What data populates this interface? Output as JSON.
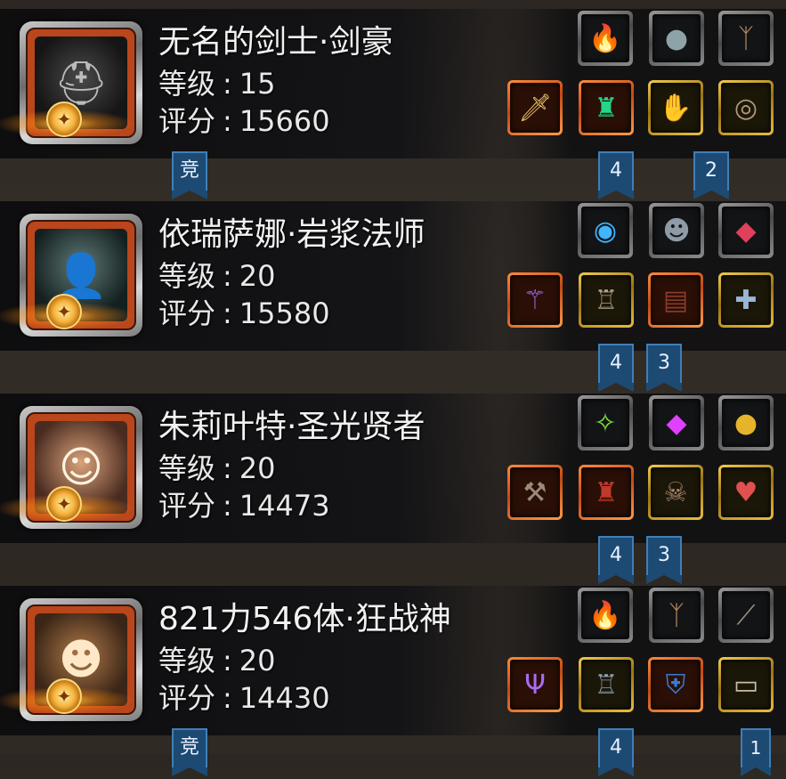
{
  "heroes": [
    {
      "name": "无名的剑士·剑豪",
      "level_label": "等级",
      "level": "15",
      "score_label": "评分",
      "score": "15660",
      "portrait_icon": "helmet-icon",
      "badge": "竞",
      "items_top": [
        "fire-orb-icon",
        "stone-icon",
        "antler-icon"
      ],
      "items_bottom": [
        "sword-icon",
        "armor-icon",
        "gauntlet-icon",
        "ring-icon"
      ],
      "ribbons": [
        "4",
        "2"
      ]
    },
    {
      "name": "依瑞萨娜·岩浆法师",
      "level_label": "等级",
      "level": "20",
      "score_label": "评分",
      "score": "15580",
      "portrait_icon": "hooded-mage-icon",
      "badge": "",
      "items_top": [
        "blue-orb-icon",
        "mask-icon",
        "red-gem-icon"
      ],
      "items_bottom": [
        "staff-icon",
        "robe-icon",
        "book-icon",
        "amulet-icon"
      ],
      "ribbons": [
        "4",
        "3"
      ]
    },
    {
      "name": "朱莉叶特·圣光贤者",
      "level_label": "等级",
      "level": "20",
      "score_label": "评分",
      "score": "14473",
      "portrait_icon": "sage-icon",
      "badge": "",
      "items_top": [
        "green-crystal-icon",
        "purple-gem-icon",
        "golden-apple-icon"
      ],
      "items_bottom": [
        "mace-icon",
        "cloak-icon",
        "skull-mask-icon",
        "heart-necklace-icon"
      ],
      "ribbons": [
        "4",
        "3"
      ]
    },
    {
      "name": "821力546体·狂战神",
      "level_label": "等级",
      "level": "20",
      "score_label": "评分",
      "score": "14430",
      "portrait_icon": "berserker-icon",
      "badge": "竞",
      "items_top": [
        "fire-orb-icon",
        "antler-icon",
        "bracer-icon"
      ],
      "items_bottom": [
        "trident-icon",
        "chest-armor-icon",
        "blue-shield-icon",
        "bracelet-icon"
      ],
      "ribbons": [
        "4",
        "1"
      ]
    }
  ]
}
